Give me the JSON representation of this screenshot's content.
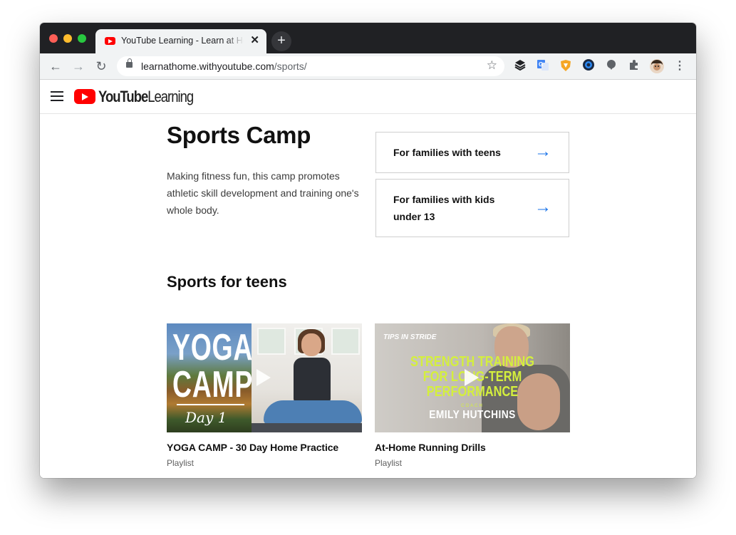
{
  "browser": {
    "tab_title": "YouTube Learning - Learn at Home",
    "tab_close": "✕",
    "new_tab": "+",
    "url_host": "learnathome.withyoutube.com",
    "url_path": "/sports/",
    "back": "←",
    "forward": "→",
    "reload": "↻",
    "bookmark": "☆",
    "extensions": [
      "layers-icon",
      "google-translate-icon",
      "brave-shield-icon",
      "circle-extension-icon",
      "download-extension-icon",
      "puzzle-icon",
      "profile-avatar",
      "more-menu-icon"
    ]
  },
  "header": {
    "logo_brand": "YouTube",
    "logo_product": "Learning"
  },
  "hero": {
    "title": "Sports Camp",
    "description": "Making fitness fun, this camp promotes athletic skill development and training one's whole body."
  },
  "family_links": [
    {
      "label": "For families with teens",
      "arrow": "→"
    },
    {
      "label": "For families with kids under 13",
      "arrow": "→"
    }
  ],
  "section": {
    "title": "Sports for teens"
  },
  "videos": [
    {
      "title": "YOGA CAMP - 30 Day Home Practice",
      "type": "Playlist",
      "thumb_line1": "YOGA",
      "thumb_line2": "CAMP",
      "thumb_day": "Day 1"
    },
    {
      "title": "At-Home Running Drills",
      "type": "Playlist",
      "thumb_brand": "TIPS IN STRIDE",
      "thumb_lines": [
        "STRENGTH TRAINING",
        "FOR LONG-TERM",
        "PERFORMANCE"
      ],
      "thumb_coach": "COACH",
      "thumb_name": "EMILY HUTCHINS"
    }
  ],
  "colors": {
    "youtube_red": "#ff0000",
    "link_blue": "#1a73e8",
    "accent_lime": "#d4ef3d",
    "tabstrip": "#202124"
  }
}
